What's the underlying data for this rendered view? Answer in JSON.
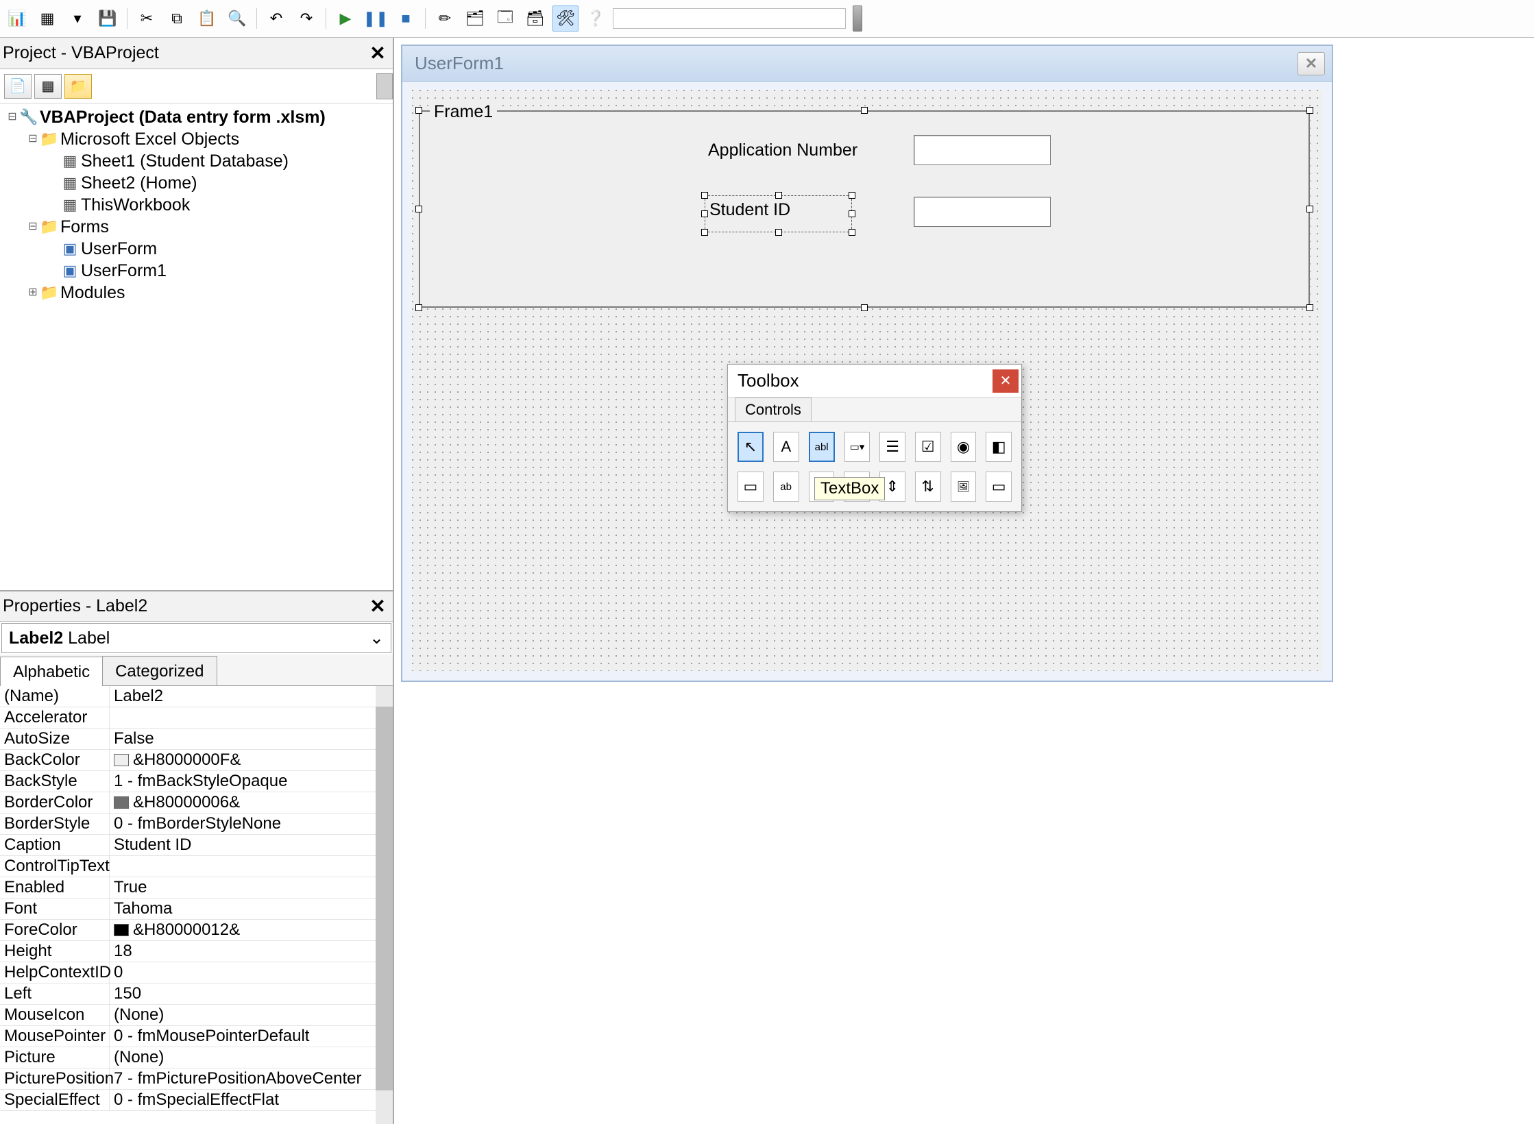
{
  "toolbar": {
    "buttons": [
      {
        "name": "excel-icon",
        "glyph": "📊"
      },
      {
        "name": "menu-icon",
        "glyph": "▦"
      },
      {
        "name": "dropdown-icon",
        "glyph": "▾"
      },
      {
        "name": "save-icon",
        "glyph": "💾"
      },
      {
        "sep": true
      },
      {
        "name": "cut-icon",
        "glyph": "✂"
      },
      {
        "name": "copy-icon",
        "glyph": "⧉"
      },
      {
        "name": "paste-icon",
        "glyph": "📋"
      },
      {
        "name": "find-icon",
        "glyph": "🔍"
      },
      {
        "sep": true
      },
      {
        "name": "undo-icon",
        "glyph": "↶"
      },
      {
        "name": "redo-icon",
        "glyph": "↷"
      },
      {
        "sep": true
      },
      {
        "name": "run-icon",
        "glyph": "▶",
        "color": "#2e8b2e"
      },
      {
        "name": "break-icon",
        "glyph": "❚❚",
        "color": "#2a6fb7"
      },
      {
        "name": "reset-icon",
        "glyph": "■",
        "color": "#2a6fb7"
      },
      {
        "sep": true
      },
      {
        "name": "design-mode-icon",
        "glyph": "✏"
      },
      {
        "name": "project-explorer-icon",
        "glyph": "🗂"
      },
      {
        "name": "properties-window-icon",
        "glyph": "🗔"
      },
      {
        "name": "object-browser-icon",
        "glyph": "🗃"
      },
      {
        "name": "toolbox-icon",
        "glyph": "🛠",
        "active": true
      },
      {
        "name": "help-icon",
        "glyph": "❔",
        "color": "#2a76c4"
      }
    ]
  },
  "projectExplorer": {
    "title": "Project - VBAProject",
    "views": [
      {
        "name": "view-code-icon",
        "glyph": "📄"
      },
      {
        "name": "view-object-icon",
        "glyph": "▦"
      },
      {
        "name": "toggle-folders-icon",
        "glyph": "📁",
        "sel": true
      }
    ],
    "tree": [
      {
        "d": 0,
        "tw": "⊟",
        "ico": "🔧",
        "lbl": "VBAProject (Data entry form .xlsm)",
        "bold": true
      },
      {
        "d": 1,
        "tw": "⊟",
        "ico": "📁",
        "cls": "ic-folder",
        "lbl": "Microsoft Excel Objects"
      },
      {
        "d": 2,
        "tw": "",
        "ico": "▦",
        "cls": "ic-sheet",
        "lbl": "Sheet1 (Student Database)"
      },
      {
        "d": 2,
        "tw": "",
        "ico": "▦",
        "cls": "ic-sheet",
        "lbl": "Sheet2 (Home)"
      },
      {
        "d": 2,
        "tw": "",
        "ico": "▦",
        "cls": "ic-sheet",
        "lbl": "ThisWorkbook"
      },
      {
        "d": 1,
        "tw": "⊟",
        "ico": "📁",
        "cls": "ic-folder",
        "lbl": "Forms"
      },
      {
        "d": 2,
        "tw": "",
        "ico": "▣",
        "cls": "ic-form",
        "lbl": "UserForm"
      },
      {
        "d": 2,
        "tw": "",
        "ico": "▣",
        "cls": "ic-form",
        "lbl": "UserForm1"
      },
      {
        "d": 1,
        "tw": "⊞",
        "ico": "📁",
        "cls": "ic-folder",
        "lbl": "Modules"
      }
    ]
  },
  "properties": {
    "title": "Properties - Label2",
    "combo": "Label2 Label",
    "tabs": [
      "Alphabetic",
      "Categorized"
    ],
    "activeTab": 0,
    "rows": [
      {
        "k": "(Name)",
        "v": "Label2"
      },
      {
        "k": "Accelerator",
        "v": ""
      },
      {
        "k": "AutoSize",
        "v": "False"
      },
      {
        "k": "BackColor",
        "sw": "#efefef",
        "v": "&H8000000F&"
      },
      {
        "k": "BackStyle",
        "v": "1 - fmBackStyleOpaque"
      },
      {
        "k": "BorderColor",
        "sw": "#6e6e6e",
        "v": "&H80000006&"
      },
      {
        "k": "BorderStyle",
        "v": "0 - fmBorderStyleNone"
      },
      {
        "k": "Caption",
        "v": "Student ID"
      },
      {
        "k": "ControlTipText",
        "v": ""
      },
      {
        "k": "Enabled",
        "v": "True"
      },
      {
        "k": "Font",
        "v": "Tahoma"
      },
      {
        "k": "ForeColor",
        "sw": "#000000",
        "v": "&H80000012&"
      },
      {
        "k": "Height",
        "v": "18"
      },
      {
        "k": "HelpContextID",
        "v": "0"
      },
      {
        "k": "Left",
        "v": "150"
      },
      {
        "k": "MouseIcon",
        "v": "(None)"
      },
      {
        "k": "MousePointer",
        "v": "0 - fmMousePointerDefault"
      },
      {
        "k": "Picture",
        "v": "(None)"
      },
      {
        "k": "PicturePosition",
        "v": "7 - fmPicturePositionAboveCenter"
      },
      {
        "k": "SpecialEffect",
        "v": "0 - fmSpecialEffectFlat"
      }
    ]
  },
  "designer": {
    "formTitle": "UserForm1",
    "frameCaption": "Frame1",
    "label1": "Application Number",
    "label2": "Student ID"
  },
  "toolbox": {
    "title": "Toolbox",
    "tab": "Controls",
    "tooltip": "TextBox",
    "row1": [
      {
        "name": "select-objects-icon",
        "glyph": "↖",
        "sel": true
      },
      {
        "name": "label-tool-icon",
        "glyph": "A"
      },
      {
        "name": "textbox-tool-icon",
        "glyph": "abl",
        "sel2": true
      },
      {
        "name": "combobox-tool-icon",
        "glyph": "▭▾"
      },
      {
        "name": "listbox-tool-icon",
        "glyph": "☰"
      },
      {
        "name": "checkbox-tool-icon",
        "glyph": "☑"
      },
      {
        "name": "optionbutton-tool-icon",
        "glyph": "◉"
      },
      {
        "name": "togglebutton-tool-icon",
        "glyph": "◧"
      }
    ],
    "row2": [
      {
        "name": "frame-tool-icon",
        "glyph": "▭"
      },
      {
        "name": "commandbutton-tool-icon",
        "glyph": "ab"
      },
      {
        "name": "tabstrip-tool-icon",
        "glyph": ""
      },
      {
        "name": "multipage-tool-icon",
        "glyph": "⊞"
      },
      {
        "name": "scrollbar-tool-icon",
        "glyph": "⇕"
      },
      {
        "name": "spinbutton-tool-icon",
        "glyph": "⇅"
      },
      {
        "name": "image-tool-icon",
        "glyph": "🖼"
      },
      {
        "name": "refedit-tool-icon",
        "glyph": "▭"
      }
    ]
  }
}
